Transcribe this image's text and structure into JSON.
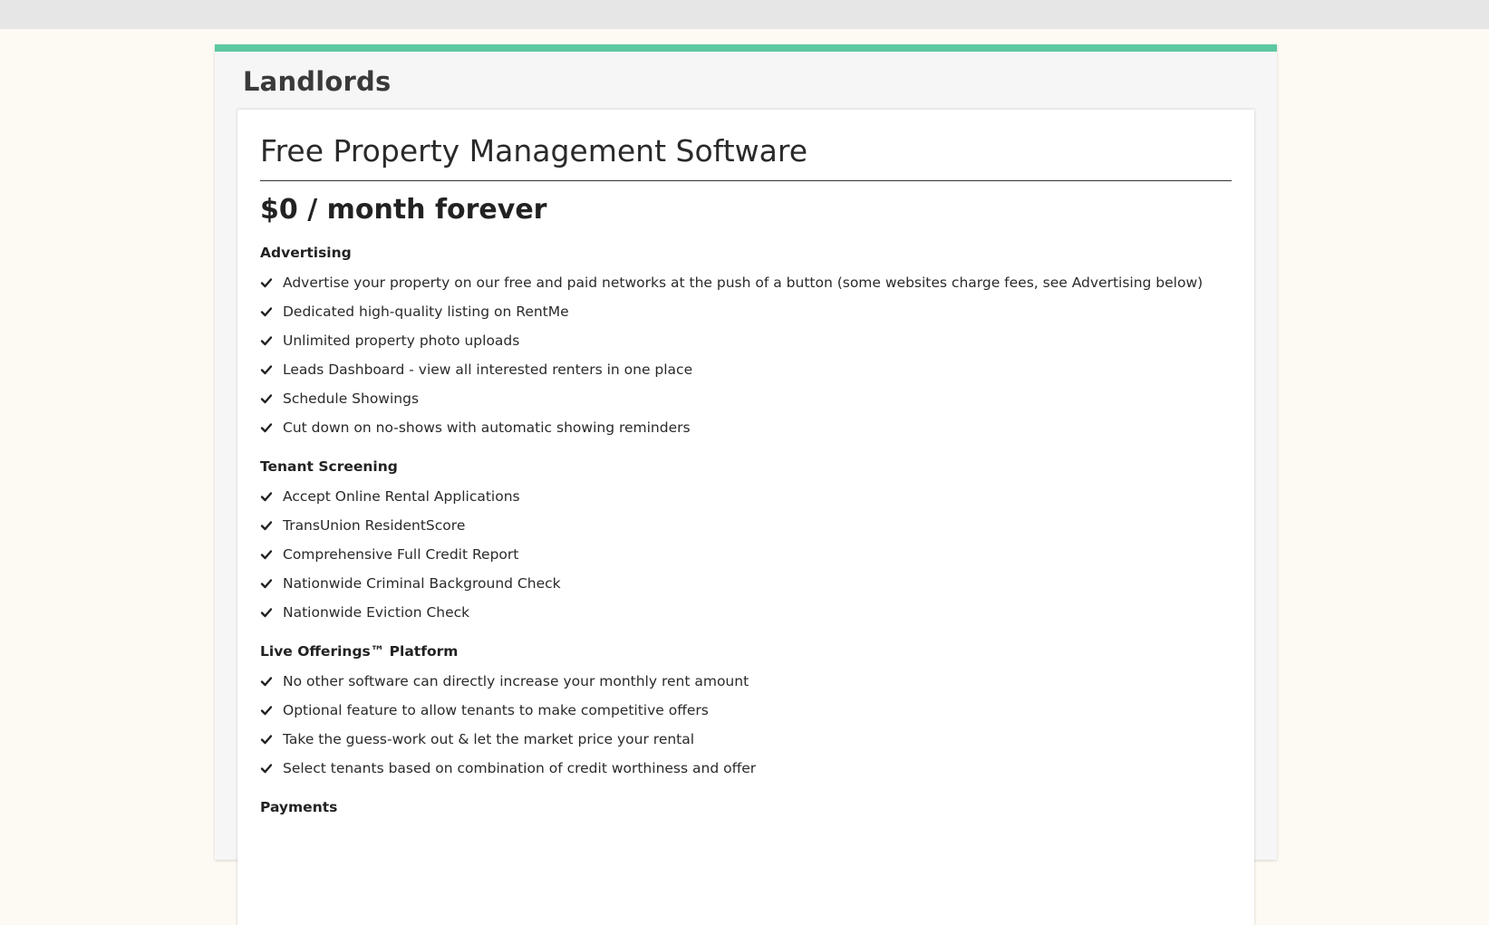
{
  "panel": {
    "title": "Landlords",
    "accent_color": "#5cc8a1"
  },
  "card": {
    "title": "Free Property Management Software",
    "price": "$0 / month forever",
    "sections": [
      {
        "title": "Advertising",
        "items": [
          "Advertise your property on our free and paid networks at the push of a button (some websites charge fees, see Advertising below)",
          "Dedicated high-quality listing on RentMe",
          "Unlimited property photo uploads",
          "Leads Dashboard - view all interested renters in one place",
          "Schedule Showings",
          "Cut down on no-shows with automatic showing reminders"
        ]
      },
      {
        "title": "Tenant Screening",
        "items": [
          "Accept Online Rental Applications",
          "TransUnion ResidentScore",
          "Comprehensive Full Credit Report",
          "Nationwide Criminal Background Check",
          "Nationwide Eviction Check"
        ]
      },
      {
        "title": "Live Offerings™ Platform",
        "items": [
          "No other software can directly increase your monthly rent amount",
          "Optional feature to allow tenants to make competitive offers",
          "Take the guess-work out & let the market price your rental",
          "Select tenants based on combination of credit worthiness and offer"
        ]
      },
      {
        "title": "Payments",
        "items": []
      }
    ]
  },
  "icons": {
    "list_bullet": "check-icon"
  }
}
